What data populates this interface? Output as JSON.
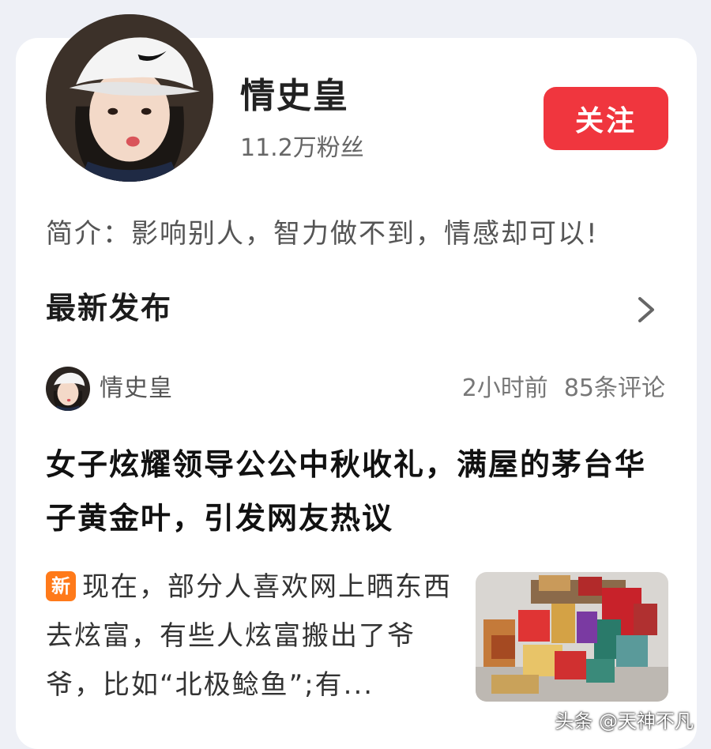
{
  "profile": {
    "name": "情史皇",
    "fans": "11.2万粉丝",
    "follow_label": "关注",
    "bio": "简介：影响别人，智力做不到，情感却可以!"
  },
  "section": {
    "title": "最新发布",
    "arrow_icon": "chevron-right-icon"
  },
  "post": {
    "author": "情史皇",
    "time": "2小时前",
    "comments": "85条评论",
    "headline": "女子炫耀领导公公中秋收礼，满屋的茅台华子黄金叶，引发网友热议",
    "badge": "新",
    "snippet": "现在，部分人喜欢网上晒东西去炫富，有些人炫富搬出了爷爷，比如“北极鲶鱼”;有..."
  },
  "watermark": "头条 @天神不凡",
  "colors": {
    "follow_button": "#f0363e",
    "new_badge": "#ff7a1a",
    "page_background": "#eef0f6"
  }
}
